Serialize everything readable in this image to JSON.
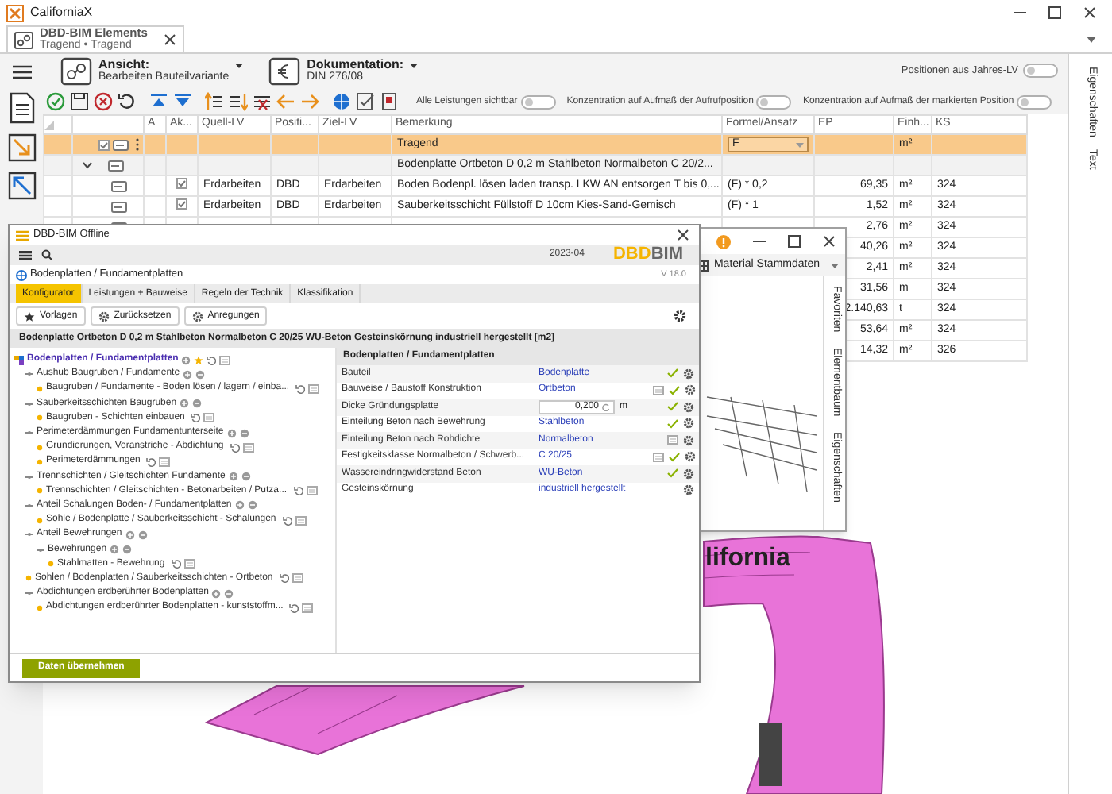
{
  "window": {
    "title": "CaliforniaX"
  },
  "document_tab": {
    "title": "DBD-BIM Elements",
    "subtitle": "Tragend • Tragend"
  },
  "view": {
    "label": "Ansicht:",
    "value": "Bearbeiten Bauteilvariante"
  },
  "documentation": {
    "label": "Dokumentation:",
    "value": "DIN 276/08"
  },
  "toggles": [
    {
      "label": "Positionen aus Jahres-LV",
      "on": false
    },
    {
      "label": "Alle Leistungen sichtbar",
      "on": false
    },
    {
      "label": "Konzentration auf Aufmaß der Aufrufposition",
      "on": false
    },
    {
      "label": "Konzentration auf Aufmaß der markierten Position",
      "on": false
    }
  ],
  "table": {
    "columns": [
      "A",
      "Ak...",
      "Quell-LV",
      "Positi...",
      "Ziel-LV",
      "Bemerkung",
      "Formel/Ansatz",
      "EP",
      "Einh...",
      "KS"
    ],
    "rows": [
      {
        "kind": "root",
        "selected": true,
        "checked": true,
        "bemerkung": "Tragend",
        "formel": "F",
        "einheit": "m²"
      },
      {
        "kind": "group",
        "selected": false,
        "expanded": true,
        "bemerkung": "Bodenplatte Ortbeton D 0,2 m Stahlbeton Normalbeton C 20/2..."
      },
      {
        "kind": "item",
        "selected": false,
        "active": true,
        "quell_lv": "Erdarbeiten",
        "position": "DBD",
        "ziel_lv": "Erdarbeiten",
        "bemerkung": "Boden Bodenpl. lösen laden transp. LKW AN entsorgen T bis 0,...",
        "formel": "(F) * 0,2",
        "ep": "69,35",
        "einheit": "m²",
        "ks": "324"
      },
      {
        "kind": "item",
        "selected": false,
        "active": true,
        "quell_lv": "Erdarbeiten",
        "position": "DBD",
        "ziel_lv": "Erdarbeiten",
        "bemerkung": "Sauberkeitsschicht Füllstoff D 10cm Kies-Sand-Gemisch",
        "formel": "(F) * 1",
        "ep": "1,52",
        "einheit": "m²",
        "ks": "324"
      },
      {
        "kind": "item",
        "selected": false,
        "ep": "2,76",
        "einheit": "m²",
        "ks": "324"
      },
      {
        "kind": "item",
        "selected": false,
        "ep": "40,26",
        "einheit": "m²",
        "ks": "324"
      },
      {
        "kind": "item",
        "selected": false,
        "ep": "2,41",
        "einheit": "m²",
        "ks": "324"
      },
      {
        "kind": "item",
        "selected": false,
        "ep": "31,56",
        "einheit": "m",
        "ks": "324"
      },
      {
        "kind": "item",
        "selected": false,
        "ep": "2.140,63",
        "einheit": "t",
        "ks": "324"
      },
      {
        "kind": "item",
        "selected": false,
        "ep": "53,64",
        "einheit": "m²",
        "ks": "324"
      },
      {
        "kind": "item",
        "selected": false,
        "ep": "14,32",
        "einheit": "m²",
        "ks": "326"
      }
    ]
  },
  "side_tabs": [
    "Eigenschaften",
    "Text"
  ],
  "model": {
    "label": "lifornia"
  },
  "material_window": {
    "source": "Material Stammdaten",
    "side_tabs": [
      "Favoriten",
      "Elementbaum",
      "Eigenschaften"
    ]
  },
  "dialog": {
    "title": "DBD-BIM Offline",
    "date": "2023-04",
    "logo": {
      "primary": "DBD",
      "secondary": "BIM"
    },
    "heading": "Bodenplatten / Fundamentplatten",
    "version": "V 18.0",
    "tabs": [
      {
        "label": "Konfigurator",
        "selected": true
      },
      {
        "label": "Leistungen + Bauweise",
        "selected": false
      },
      {
        "label": "Regeln der Technik",
        "selected": false
      },
      {
        "label": "Klassifikation",
        "selected": false
      }
    ],
    "buttons": [
      "Vorlagen",
      "Zurücksetzen",
      "Anregungen"
    ],
    "description": "Bodenplatte Ortbeton D 0,2 m Stahlbeton Normalbeton C 20/25 WU-Beton Gesteinskörnung industriell hergestellt [m2]",
    "tree": [
      {
        "kind": "root",
        "label": "Bodenplatten / Fundamentplatten",
        "children": [
          {
            "kind": "group",
            "label": "Aushub Baugruben / Fundamente",
            "children": [
              {
                "kind": "leaf",
                "label": "Baugruben / Fundamente - Boden lösen / lagern / einba..."
              }
            ]
          },
          {
            "kind": "group",
            "label": "Sauberkeitsschichten Baugruben",
            "children": [
              {
                "kind": "leaf",
                "label": "Baugruben - Schichten einbauen"
              }
            ]
          },
          {
            "kind": "group",
            "label": "Perimeterdämmungen Fundamentunterseite",
            "children": [
              {
                "kind": "leaf",
                "label": "Grundierungen, Voranstriche - Abdichtung"
              },
              {
                "kind": "leaf",
                "label": "Perimeterdämmungen"
              }
            ]
          },
          {
            "kind": "group",
            "label": "Trennschichten / Gleitschichten Fundamente",
            "children": [
              {
                "kind": "leaf",
                "label": "Trennschichten / Gleitschichten - Betonarbeiten / Putza..."
              }
            ]
          },
          {
            "kind": "group",
            "label": "Anteil Schalungen Boden- / Fundamentplatten",
            "children": [
              {
                "kind": "leaf",
                "label": "Sohle / Bodenplatte / Sauberkeitsschicht - Schalungen"
              }
            ]
          },
          {
            "kind": "group",
            "label": "Anteil Bewehrungen",
            "children": [
              {
                "kind": "group",
                "label": "Bewehrungen",
                "children": [
                  {
                    "kind": "leaf",
                    "label": "Stahlmatten - Bewehrung"
                  }
                ]
              }
            ]
          },
          {
            "kind": "leaf",
            "label": "Sohlen / Bodenplatten / Sauberkeitsschichten - Ortbeton"
          },
          {
            "kind": "group",
            "label": "Abdichtungen erdberührter Bodenplatten",
            "children": [
              {
                "kind": "leaf",
                "label": "Abdichtungen erdberührter Bodenplatten - kunststoffm..."
              }
            ]
          }
        ]
      }
    ],
    "properties": {
      "heading": "Bodenplatten / Fundamentplatten",
      "rows": [
        {
          "kind": "link",
          "label": "Bauteil",
          "value": "Bodenplatte",
          "note": false,
          "confirmed": true
        },
        {
          "kind": "link",
          "label": "Bauweise / Baustoff Konstruktion",
          "value": "Ortbeton",
          "note": true,
          "confirmed": true
        },
        {
          "kind": "number",
          "label": "Dicke Gründungsplatte",
          "value": "0,200",
          "unit": "m",
          "note": false,
          "confirmed": true
        },
        {
          "kind": "link",
          "label": "Einteilung Beton nach Bewehrung",
          "value": "Stahlbeton",
          "note": false,
          "confirmed": true
        },
        {
          "kind": "link",
          "label": "Einteilung Beton nach Rohdichte",
          "value": "Normalbeton",
          "note": true,
          "confirmed": false
        },
        {
          "kind": "link",
          "label": "Festigkeitsklasse Normalbeton / Schwerb...",
          "value": "C 20/25",
          "note": true,
          "confirmed": true
        },
        {
          "kind": "link",
          "label": "Wassereindringwiderstand Beton",
          "value": "WU-Beton",
          "note": false,
          "confirmed": true
        },
        {
          "kind": "link",
          "label": "Gesteinskörnung",
          "value": "industriell hergestellt",
          "note": false,
          "confirmed": false
        }
      ]
    },
    "submit": "Daten übernehmen"
  }
}
